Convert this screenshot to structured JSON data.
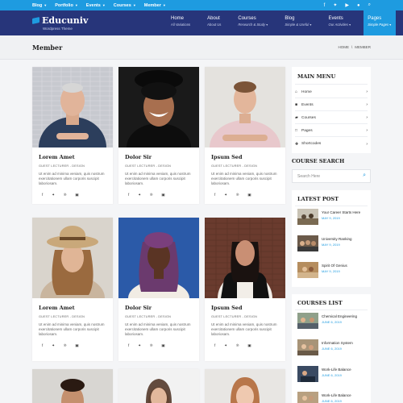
{
  "topbar": {
    "menu": [
      "Blog",
      "Portfolio",
      "Events",
      "Courses",
      "Member"
    ],
    "icons": [
      "facebook-icon",
      "twitter-icon",
      "youtube-icon",
      "user-icon",
      "search-icon"
    ]
  },
  "header": {
    "logo": "Educuniv",
    "tagline": "Wordpress Theme",
    "nav": [
      {
        "label": "Home",
        "sub": "All Variations"
      },
      {
        "label": "About",
        "sub": "About Us"
      },
      {
        "label": "Courses",
        "sub": "Research & Study"
      },
      {
        "label": "Blog",
        "sub": "Simple & Useful"
      },
      {
        "label": "Events",
        "sub": "Our Activities"
      },
      {
        "label": "Pages",
        "sub": "Simple Pages"
      }
    ]
  },
  "page": {
    "title": "Member",
    "breadcrumb": [
      "HOME",
      "\\",
      "MEMBER"
    ]
  },
  "members": [
    {
      "name": "Lorem Amet",
      "role": "GUEST LECTURER - DESIGN",
      "bio": "Ut enim ad minima veniam, quis nostrum exercitationem ullam corporis suscipit laboriosam."
    },
    {
      "name": "Dolor Sir",
      "role": "GUEST LECTURER - DESIGN",
      "bio": "Ut enim ad minima veniam, quis nostrum exercitationem ullam corporis suscipit laboriosam."
    },
    {
      "name": "Ipsum Sed",
      "role": "GUEST LECTURER - DESIGN",
      "bio": "Ut enim ad minima veniam, quis nostrum exercitationem ullam corporis suscipit laboriosam."
    },
    {
      "name": "Lorem Amet",
      "role": "GUEST LECTURER - DESIGN",
      "bio": "Ut enim ad minima veniam, quis nostrum exercitationem ullam corporis suscipit laboriosam."
    },
    {
      "name": "Dolor Sir",
      "role": "GUEST LECTURER - DESIGN",
      "bio": "Ut enim ad minima veniam, quis nostrum exercitationem ullam corporis suscipit laboriosam."
    },
    {
      "name": "Ipsum Sed",
      "role": "GUEST LECTURER - DESIGN",
      "bio": "Ut enim ad minima veniam, quis nostrum exercitationem ullam corporis suscipit laboriosam."
    }
  ],
  "social_icons": {
    "f": "f",
    "t": "✦",
    "p": "℗",
    "i": "▣"
  },
  "sidebar": {
    "main_menu_title": "MAIN MENU",
    "main_menu": [
      {
        "icon": "⌂",
        "label": "Home"
      },
      {
        "icon": "■",
        "label": "Events"
      },
      {
        "icon": "▰",
        "label": "Courses"
      },
      {
        "icon": "□",
        "label": "Pages"
      },
      {
        "icon": "✚",
        "label": "Shortcodes"
      }
    ],
    "search_title": "COURSE SEARCH",
    "search_placeholder": "Search Here",
    "latest_title": "LATEST POST",
    "latest": [
      {
        "title": "Your Career Starts Here",
        "date": "MAY 9, 2019"
      },
      {
        "title": "University Ranking",
        "date": "MAY 9, 2019"
      },
      {
        "title": "Spirit Of Genius",
        "date": "MAY 9, 2019"
      }
    ],
    "courses_title": "COURSES LIST",
    "courses": [
      {
        "title": "Chemical Engineering",
        "date": "JUNE 6, 2019"
      },
      {
        "title": "Information System",
        "date": "JUNE 6, 2019"
      },
      {
        "title": "Work-Life Balance",
        "date": "JUNE 6, 2019"
      },
      {
        "title": "Work-Life Balance",
        "date": "JUNE 6, 2019"
      }
    ]
  },
  "colors": {
    "accent": "#1e9be0",
    "header": "#27357a"
  }
}
